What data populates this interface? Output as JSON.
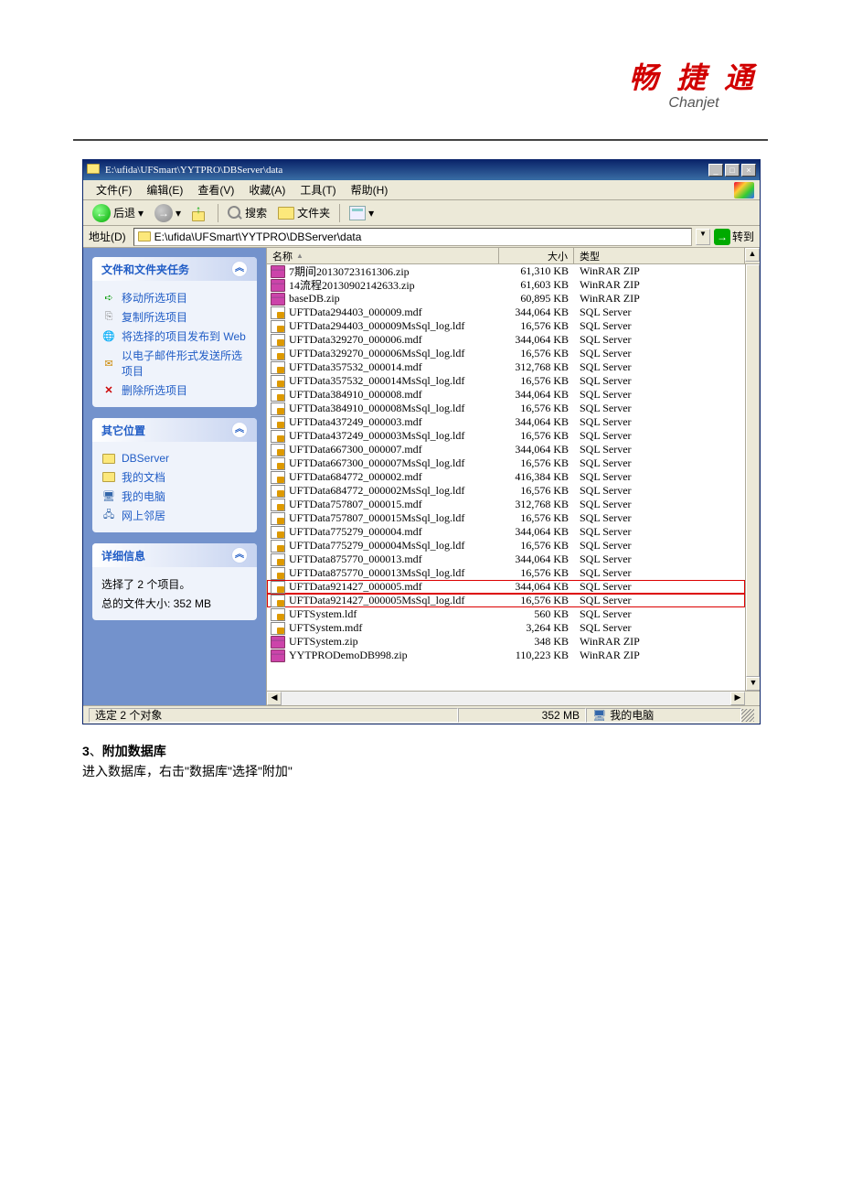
{
  "logo": {
    "cn": "畅 捷 通",
    "en": "Chanjet"
  },
  "window": {
    "title": "E:\\ufida\\UFSmart\\YYTPRO\\DBServer\\data",
    "menus": [
      "文件(F)",
      "编辑(E)",
      "查看(V)",
      "收藏(A)",
      "工具(T)",
      "帮助(H)"
    ],
    "toolbar": {
      "back": "后退",
      "search": "搜索",
      "folders": "文件夹"
    },
    "address": {
      "label": "地址(D)",
      "path": "E:\\ufida\\UFSmart\\YYTPRO\\DBServer\\data",
      "go": "转到"
    }
  },
  "sidebar": {
    "tasks": {
      "title": "文件和文件夹任务",
      "items": [
        "移动所选项目",
        "复制所选项目",
        "将选择的项目发布到 Web",
        "以电子邮件形式发送所选项目",
        "删除所选项目"
      ]
    },
    "places": {
      "title": "其它位置",
      "items": [
        "DBServer",
        "我的文档",
        "我的电脑",
        "网上邻居"
      ]
    },
    "details": {
      "title": "详细信息",
      "line1": "选择了 2 个项目。",
      "line2": "总的文件大小: 352 MB"
    }
  },
  "columns": {
    "name": "名称",
    "size": "大小",
    "type": "类型"
  },
  "files": [
    {
      "name": "7期间20130723161306.zip",
      "size": "61,310 KB",
      "type": "WinRAR ZIP",
      "icon": "zip"
    },
    {
      "name": "14流程20130902142633.zip",
      "size": "61,603 KB",
      "type": "WinRAR ZIP",
      "icon": "zip"
    },
    {
      "name": "baseDB.zip",
      "size": "60,895 KB",
      "type": "WinRAR ZIP",
      "icon": "zip"
    },
    {
      "name": "UFTData294403_000009.mdf",
      "size": "344,064 KB",
      "type": "SQL Server",
      "icon": "mdf"
    },
    {
      "name": "UFTData294403_000009MsSql_log.ldf",
      "size": "16,576 KB",
      "type": "SQL Server",
      "icon": "ldf"
    },
    {
      "name": "UFTData329270_000006.mdf",
      "size": "344,064 KB",
      "type": "SQL Server",
      "icon": "mdf"
    },
    {
      "name": "UFTData329270_000006MsSql_log.ldf",
      "size": "16,576 KB",
      "type": "SQL Server",
      "icon": "ldf"
    },
    {
      "name": "UFTData357532_000014.mdf",
      "size": "312,768 KB",
      "type": "SQL Server",
      "icon": "mdf"
    },
    {
      "name": "UFTData357532_000014MsSql_log.ldf",
      "size": "16,576 KB",
      "type": "SQL Server",
      "icon": "ldf"
    },
    {
      "name": "UFTData384910_000008.mdf",
      "size": "344,064 KB",
      "type": "SQL Server",
      "icon": "mdf"
    },
    {
      "name": "UFTData384910_000008MsSql_log.ldf",
      "size": "16,576 KB",
      "type": "SQL Server",
      "icon": "ldf"
    },
    {
      "name": "UFTData437249_000003.mdf",
      "size": "344,064 KB",
      "type": "SQL Server",
      "icon": "mdf"
    },
    {
      "name": "UFTData437249_000003MsSql_log.ldf",
      "size": "16,576 KB",
      "type": "SQL Server",
      "icon": "ldf"
    },
    {
      "name": "UFTData667300_000007.mdf",
      "size": "344,064 KB",
      "type": "SQL Server",
      "icon": "mdf"
    },
    {
      "name": "UFTData667300_000007MsSql_log.ldf",
      "size": "16,576 KB",
      "type": "SQL Server",
      "icon": "ldf"
    },
    {
      "name": "UFTData684772_000002.mdf",
      "size": "416,384 KB",
      "type": "SQL Server",
      "icon": "mdf"
    },
    {
      "name": "UFTData684772_000002MsSql_log.ldf",
      "size": "16,576 KB",
      "type": "SQL Server",
      "icon": "ldf"
    },
    {
      "name": "UFTData757807_000015.mdf",
      "size": "312,768 KB",
      "type": "SQL Server",
      "icon": "mdf"
    },
    {
      "name": "UFTData757807_000015MsSql_log.ldf",
      "size": "16,576 KB",
      "type": "SQL Server",
      "icon": "ldf"
    },
    {
      "name": "UFTData775279_000004.mdf",
      "size": "344,064 KB",
      "type": "SQL Server",
      "icon": "mdf"
    },
    {
      "name": "UFTData775279_000004MsSql_log.ldf",
      "size": "16,576 KB",
      "type": "SQL Server",
      "icon": "ldf"
    },
    {
      "name": "UFTData875770_000013.mdf",
      "size": "344,064 KB",
      "type": "SQL Server",
      "icon": "mdf"
    },
    {
      "name": "UFTData875770_000013MsSql_log.ldf",
      "size": "16,576 KB",
      "type": "SQL Server",
      "icon": "ldf"
    },
    {
      "name": "UFTData921427_000005.mdf",
      "size": "344,064 KB",
      "type": "SQL Server",
      "icon": "mdf",
      "hl": true
    },
    {
      "name": "UFTData921427_000005MsSql_log.ldf",
      "size": "16,576 KB",
      "type": "SQL Server",
      "icon": "ldf",
      "hl": true
    },
    {
      "name": "UFTSystem.ldf",
      "size": "560 KB",
      "type": "SQL Server",
      "icon": "ldf"
    },
    {
      "name": "UFTSystem.mdf",
      "size": "3,264 KB",
      "type": "SQL Server",
      "icon": "mdf"
    },
    {
      "name": "UFTSystem.zip",
      "size": "348 KB",
      "type": "WinRAR ZIP",
      "icon": "zip"
    },
    {
      "name": "YYTPRODemoDB998.zip",
      "size": "110,223 KB",
      "type": "WinRAR ZIP",
      "icon": "zip"
    }
  ],
  "statusbar": {
    "selected": "选定 2 个对象",
    "size": "352 MB",
    "location": "我的电脑"
  },
  "article": {
    "heading_num": "3",
    "heading_sep": "、",
    "heading": "附加数据库",
    "body": "进入数据库，右击\"数据库\"选择\"附加\""
  }
}
